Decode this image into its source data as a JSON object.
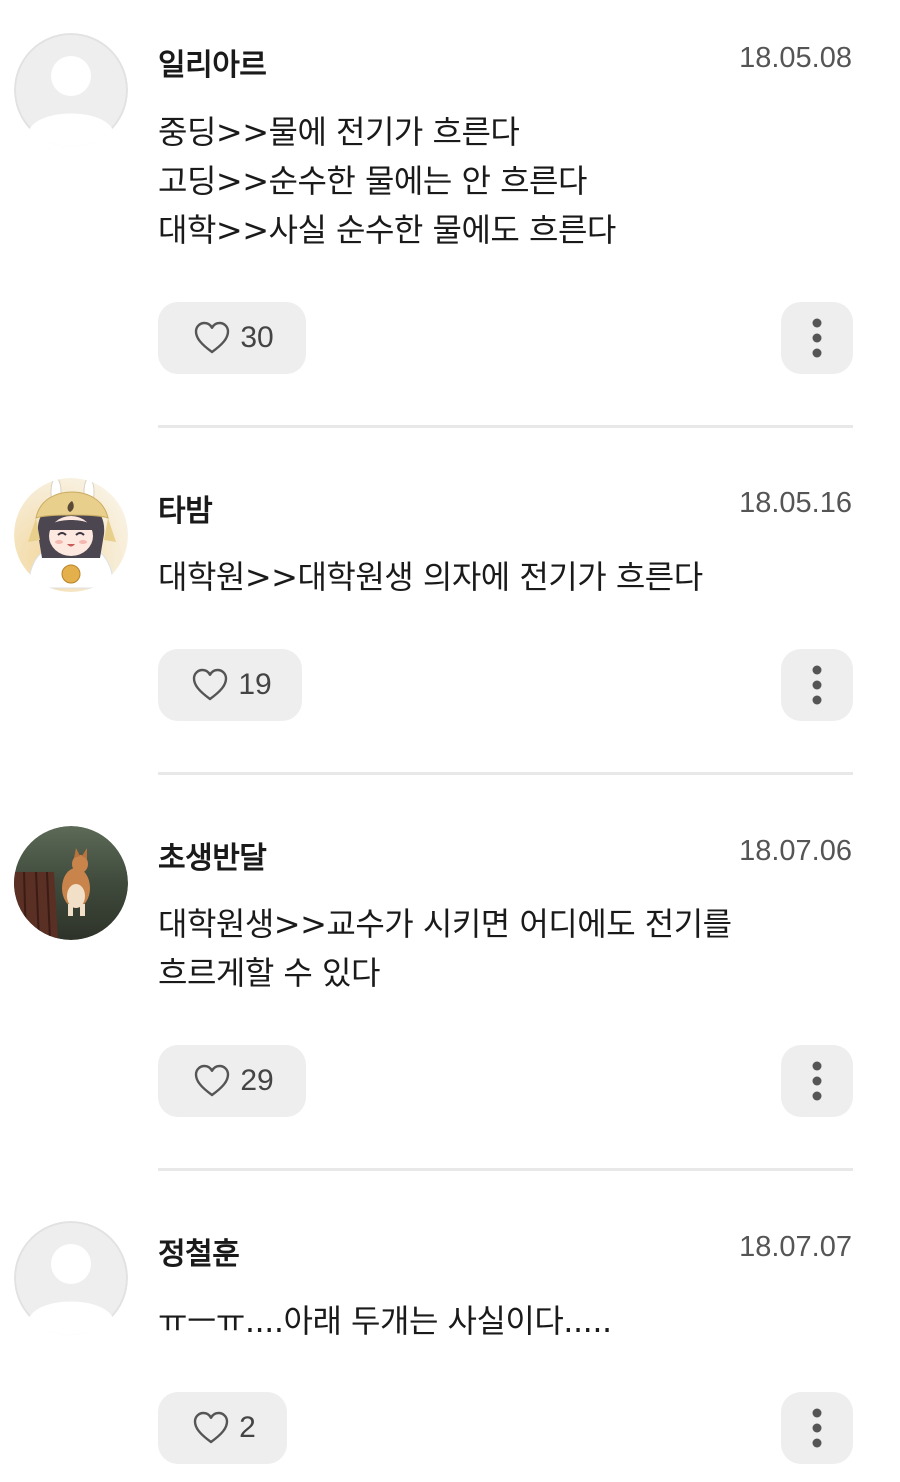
{
  "comments": [
    {
      "author": "일리아르",
      "date": "18.05.08",
      "lines": [
        "중딩>>물에 전기가 흐른다",
        "고딩>>순수한 물에는 안 흐른다",
        "대학>>사실 순수한 물에도 흐른다"
      ],
      "likes": "30",
      "avatar": "default-avatar-icon"
    },
    {
      "author": "타밤",
      "date": "18.05.16",
      "lines": [
        "대학원>>대학원생 의자에 전기가 흐른다"
      ],
      "likes": "19",
      "avatar": "anime-character-avatar"
    },
    {
      "author": "초생반달",
      "date": "18.07.06",
      "lines": [
        "대학원생>>교수가 시키면 어디에도 전기를",
        "흐르게할 수 있다"
      ],
      "likes": "29",
      "avatar": "corgi-dog-photo-avatar"
    },
    {
      "author": "정철훈",
      "date": "18.07.07",
      "lines": [
        "ㅠㅡㅠ....아래 두개는 사실이다....."
      ],
      "likes": "2",
      "avatar": "default-avatar-icon"
    }
  ],
  "icons": {
    "like": "heart-icon",
    "more": "more-vertical-icon"
  },
  "colors": {
    "button_bg": "#eeeeee",
    "divider": "#e8e8e8",
    "date_text": "#555555"
  }
}
